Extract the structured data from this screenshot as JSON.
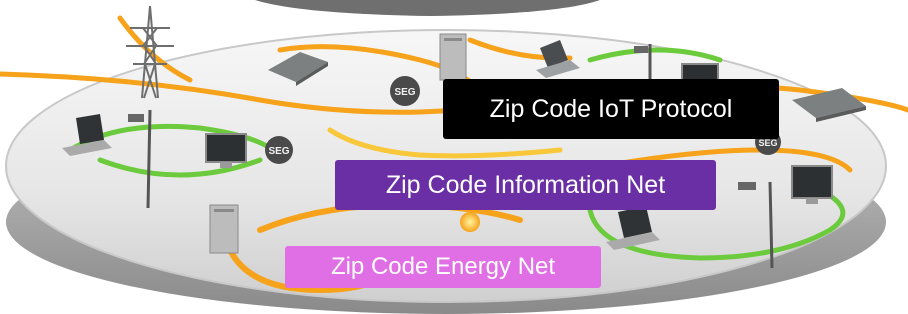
{
  "labels": {
    "iot_protocol": "Zip Code IoT Protocol",
    "information_net": "Zip Code Information Net",
    "energy_net": "Zip Code Energy Net"
  },
  "gateways": [
    "SEG",
    "SEG",
    "SEG"
  ],
  "colors": {
    "iot_label_bg": "#000000",
    "info_label_bg": "#6b2fa5",
    "energy_label_bg": "#e06ee4",
    "energy_line": "#f6a21a",
    "info_line": "#6ccb3c",
    "platform": "#d9d9d9"
  },
  "icons": [
    "power-tower-icon",
    "server-icon",
    "laptop-icon",
    "monitor-icon",
    "camera-icon",
    "gateway-icon"
  ]
}
